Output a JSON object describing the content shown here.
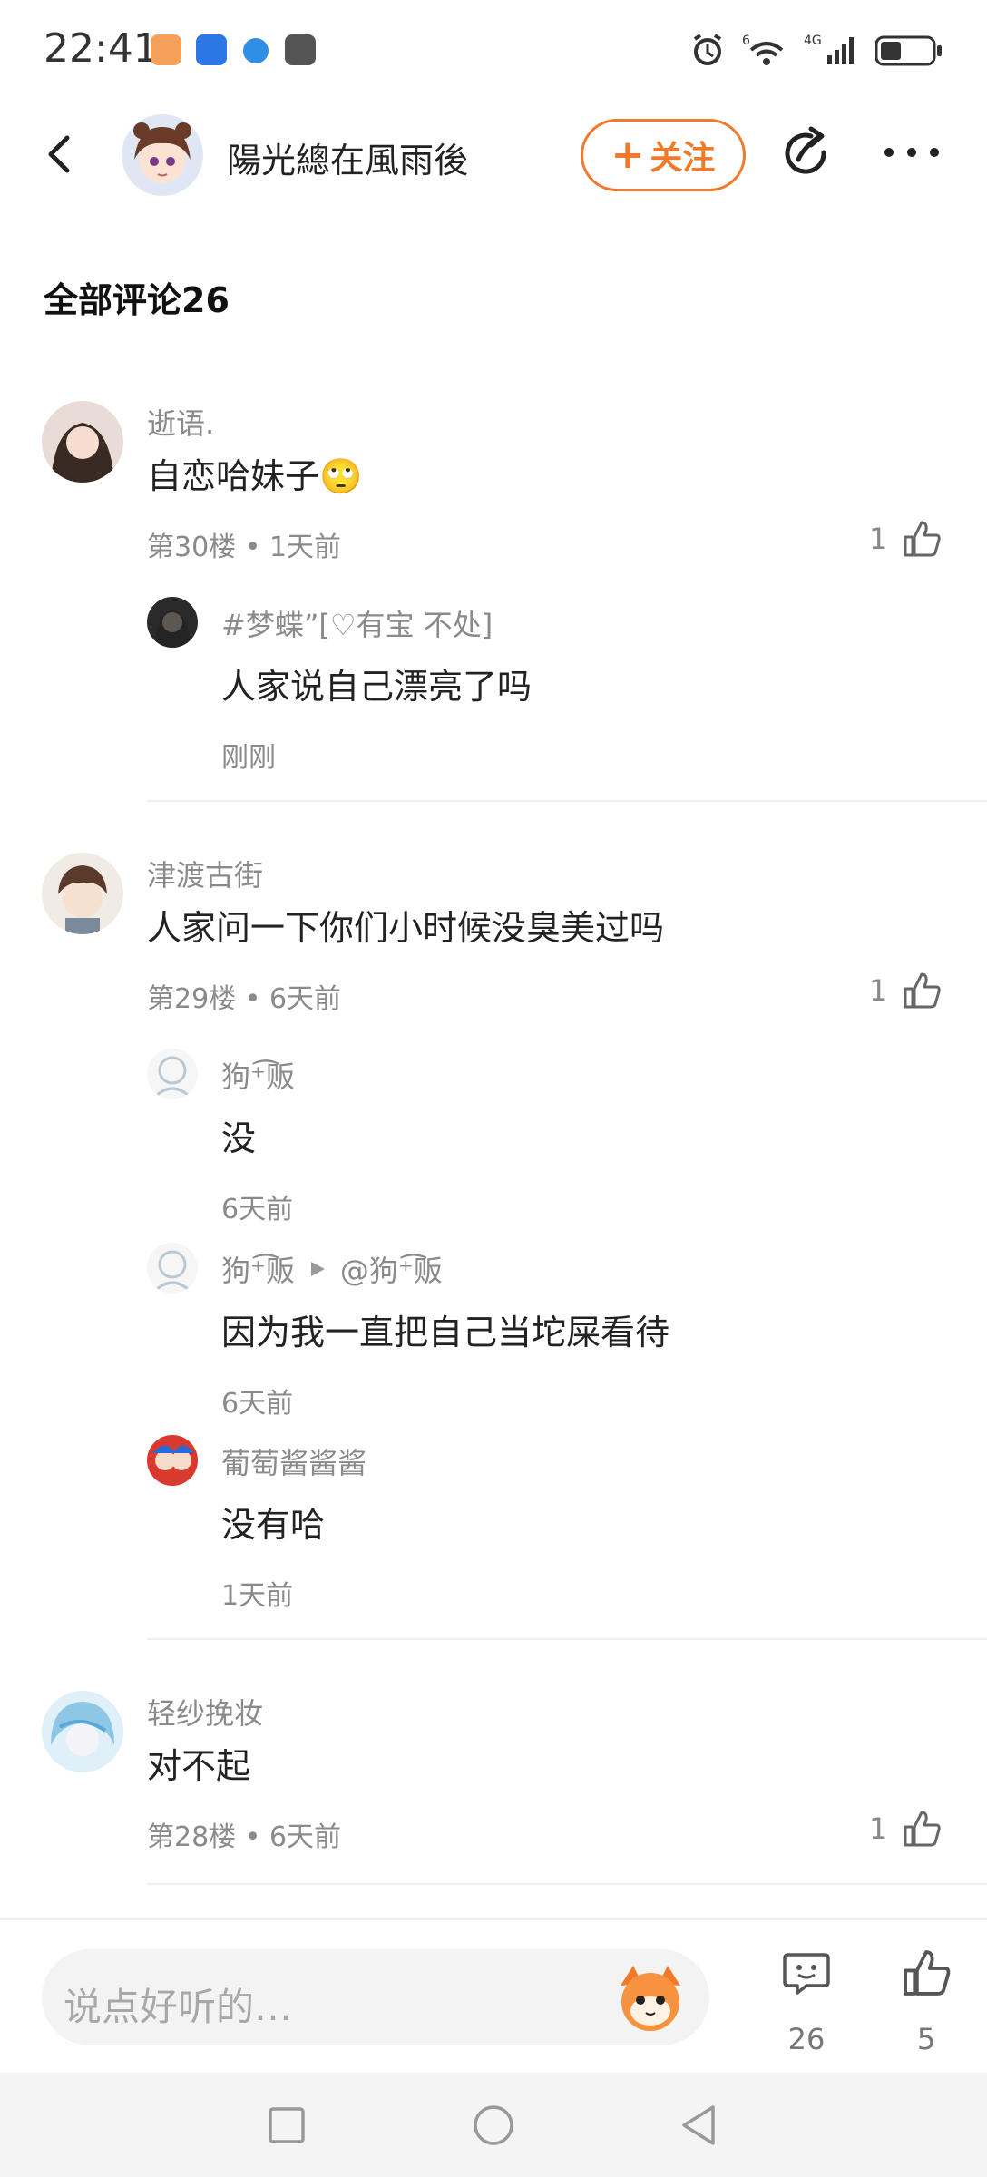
{
  "status_bar": {
    "time": "22:41",
    "network": "4G",
    "sim": "6"
  },
  "header": {
    "title": "陽光總在風雨後",
    "follow_label": "关注"
  },
  "section_title": "全部评论26",
  "comments": [
    {
      "name": "逝语.",
      "text": "自恋哈妹子🙄",
      "meta": "第30楼 • 1天前",
      "likes": "1",
      "replies": [
        {
          "name": "#梦蝶”[♡有宝 不处]",
          "text": "人家说自己漂亮了吗",
          "time": "刚刚"
        }
      ]
    },
    {
      "name": "津渡古街",
      "text": "人家问一下你们小时候没臭美过吗",
      "meta": "第29楼 • 6天前",
      "likes": "1",
      "replies": [
        {
          "name": "狗⁺͡贩",
          "text": "没",
          "time": "6天前"
        },
        {
          "name": "狗⁺͡贩",
          "reply_to": "@狗⁺͡贩",
          "text": "因为我一直把自己当坨屎看待",
          "time": "6天前"
        },
        {
          "name": "葡萄酱酱酱",
          "text": "没有哈",
          "time": "1天前"
        }
      ]
    },
    {
      "name": "轻纱挽妆",
      "text": "对不起",
      "meta": "第28楼 • 6天前",
      "likes": "1",
      "replies": []
    }
  ],
  "bottom_bar": {
    "input_placeholder": "说点好听的…",
    "comment_count": "26",
    "like_count": "5"
  },
  "colors": {
    "accent": "#f07a2a",
    "secondary_text": "#8a8a8a"
  },
  "icons": [
    "back-icon",
    "share-icon",
    "more-icon",
    "like-icon",
    "comment-icon",
    "mascot-icon"
  ]
}
